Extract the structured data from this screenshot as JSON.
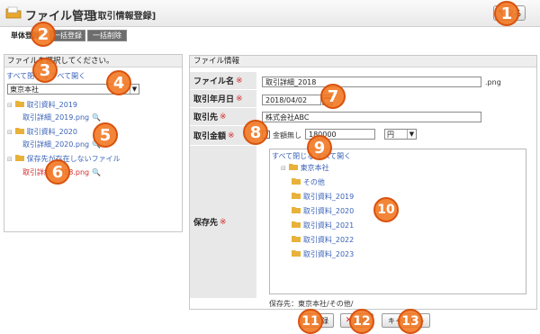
{
  "header": {
    "title": "ファイル管理",
    "subtitle": "[取引情報登録]",
    "back_label": "戻る"
  },
  "tabs": [
    "単体登録",
    "一括登録",
    "一括削除"
  ],
  "left_panel": {
    "header": "ファイルを選択してください。",
    "close_all": "すべて閉じる",
    "open_all": "すべて開く",
    "select_value": "東京本社",
    "tree": [
      {
        "label": "取引資料_2019",
        "kind": "folder"
      },
      {
        "label": "取引詳細_2019.png",
        "kind": "file"
      },
      {
        "label": "取引資料_2020",
        "kind": "folder"
      },
      {
        "label": "取引詳細_2020.png",
        "kind": "file"
      },
      {
        "label": "保存先が存在しないファイル",
        "kind": "folder"
      },
      {
        "label": "取引詳細_2018.png",
        "kind": "file-red"
      }
    ]
  },
  "right_panel": {
    "header": "ファイル情報",
    "required_mark": "※",
    "rows": {
      "filename": {
        "label": "ファイル名",
        "value": "取引詳細_2018",
        "ext": ".png"
      },
      "date": {
        "label": "取引年月日",
        "value": "2018/04/02"
      },
      "partner": {
        "label": "取引先",
        "value": "株式会社ABC"
      },
      "amount": {
        "label": "取引金額",
        "no_amount": "金額無し",
        "value": "180000",
        "currency": "円"
      },
      "saveto": {
        "label": "保存先"
      }
    },
    "save_tree": {
      "close_all": "すべて閉じる",
      "open_all": "すべて開く",
      "root": "東京本社",
      "children": [
        "その他",
        "取引資料_2019",
        "取引資料_2020",
        "取引資料_2021",
        "取引資料_2022",
        "取引資料_2023"
      ]
    },
    "save_path": "保存先：東京本社/その他/"
  },
  "buttons": {
    "register": "登録",
    "delete": "削除",
    "cancel": "キャンセル"
  },
  "markers": [
    "1",
    "2",
    "3",
    "4",
    "5",
    "6",
    "7",
    "8",
    "9",
    "10",
    "11",
    "12",
    "13"
  ],
  "colors": {
    "marker_fill": "#f27822",
    "link": "#3a62b8",
    "required": "#d32d2d",
    "folder": "#e8b13a"
  }
}
